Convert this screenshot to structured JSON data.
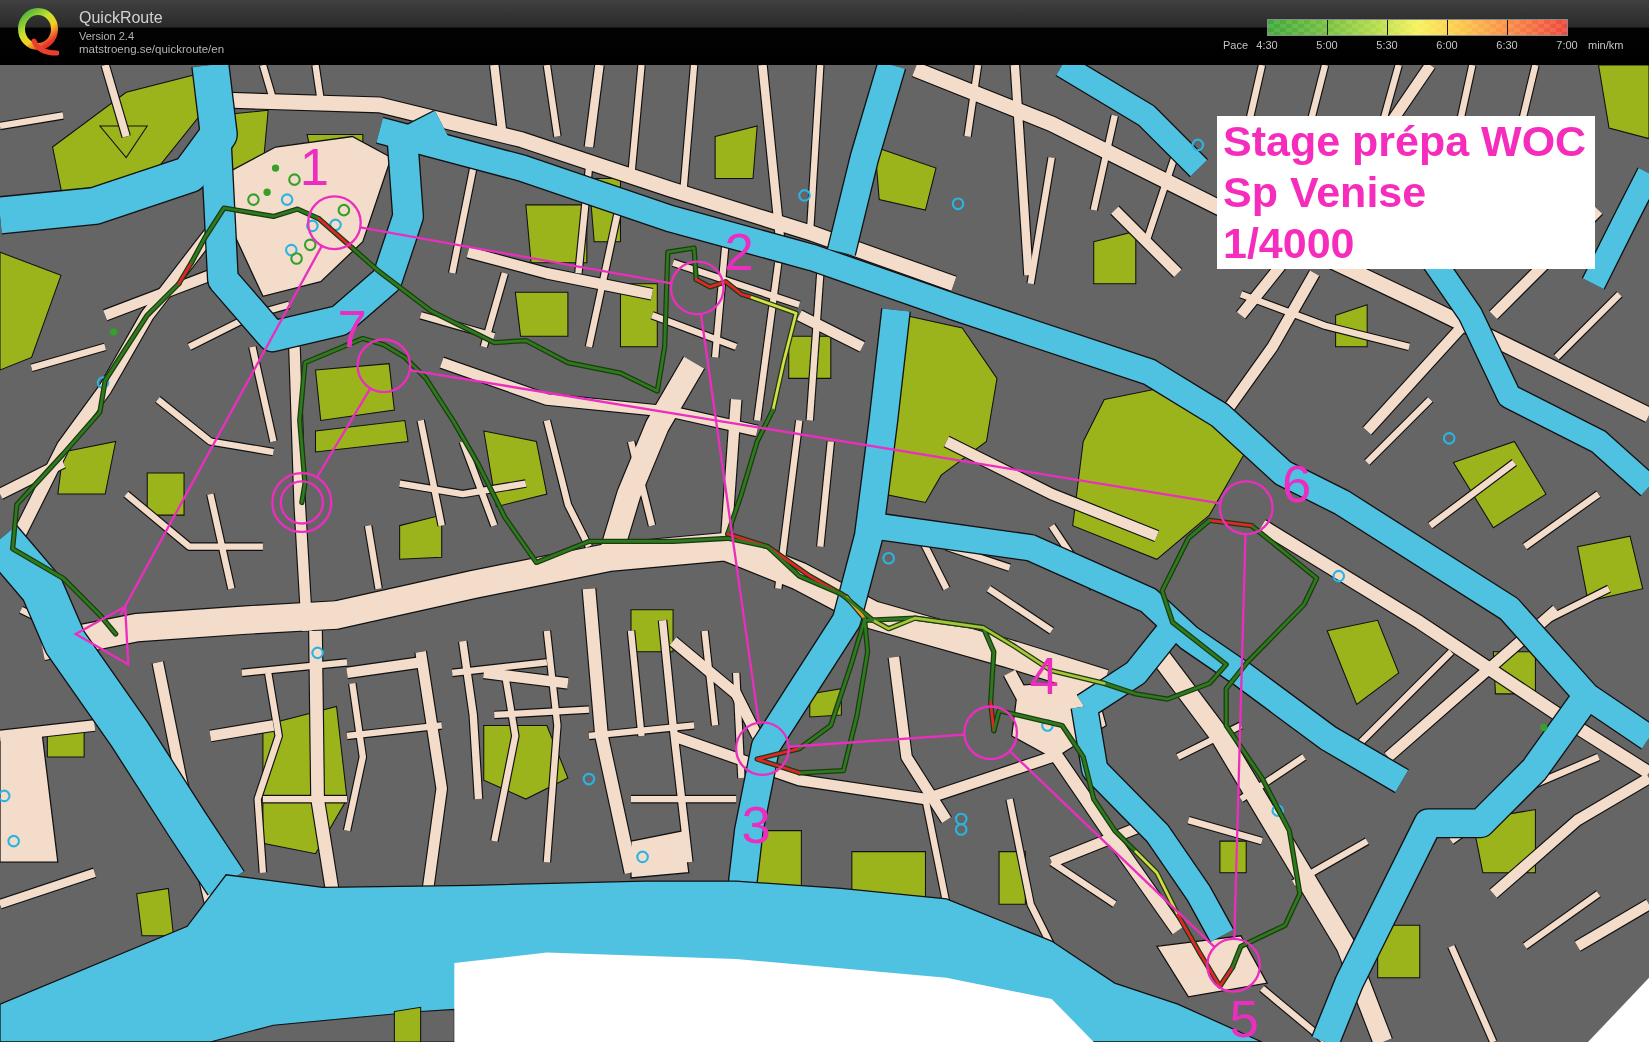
{
  "app": {
    "name": "QuickRoute",
    "version": "Version 2.4",
    "url": "matstroeng.se/quickroute/en"
  },
  "pace_legend": {
    "label": "Pace",
    "ticks": [
      "4:30",
      "5:00",
      "5:30",
      "6:00",
      "6:30",
      "7:00"
    ],
    "unit": "min/km"
  },
  "map": {
    "caption": [
      "Stage prépa WOC",
      "Sp Venise",
      "1/4000"
    ],
    "course": [
      {
        "kind": "start"
      },
      {
        "kind": "control",
        "number": "1"
      },
      {
        "kind": "control",
        "number": "2"
      },
      {
        "kind": "control",
        "number": "3"
      },
      {
        "kind": "control",
        "number": "4"
      },
      {
        "kind": "control",
        "number": "5"
      },
      {
        "kind": "control",
        "number": "6"
      },
      {
        "kind": "control",
        "number": "7"
      },
      {
        "kind": "finish"
      }
    ]
  }
}
